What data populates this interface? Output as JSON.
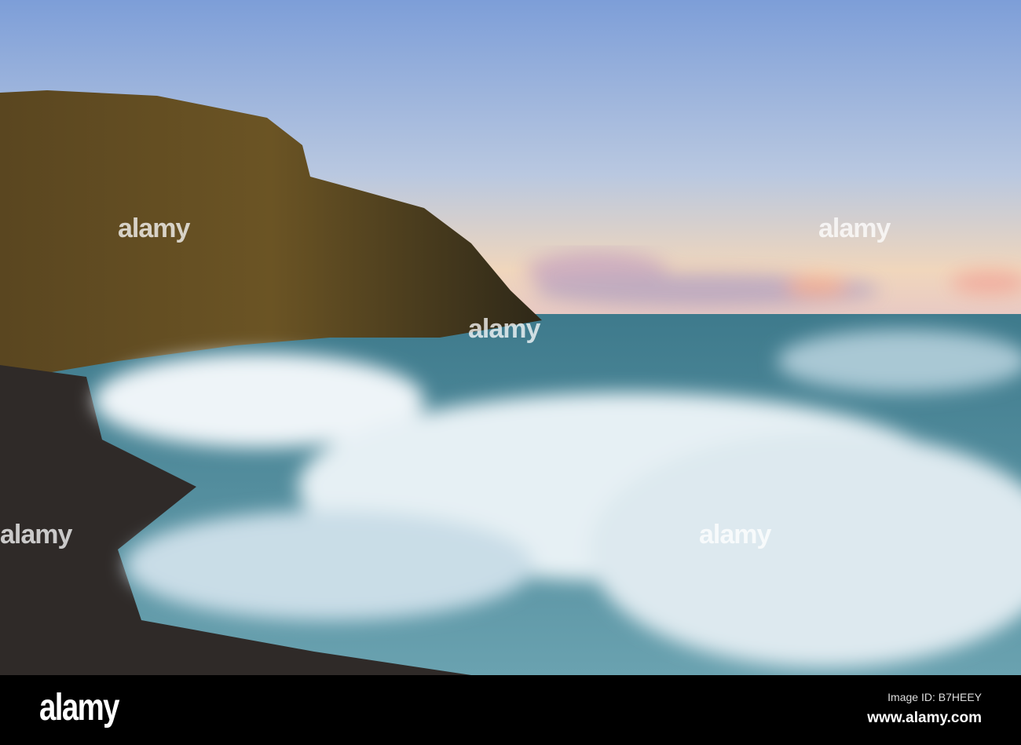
{
  "watermark": {
    "text": "alamy"
  },
  "footer": {
    "logo": "alamy",
    "image_id": "Image ID: B7HEEY",
    "url": "www.alamy.com"
  },
  "colors": {
    "sky_top": "#7f9fd6",
    "sky_horizon": "#f4d0b0",
    "sea": "#4f8a97",
    "cliff": "#4a3a1e"
  }
}
